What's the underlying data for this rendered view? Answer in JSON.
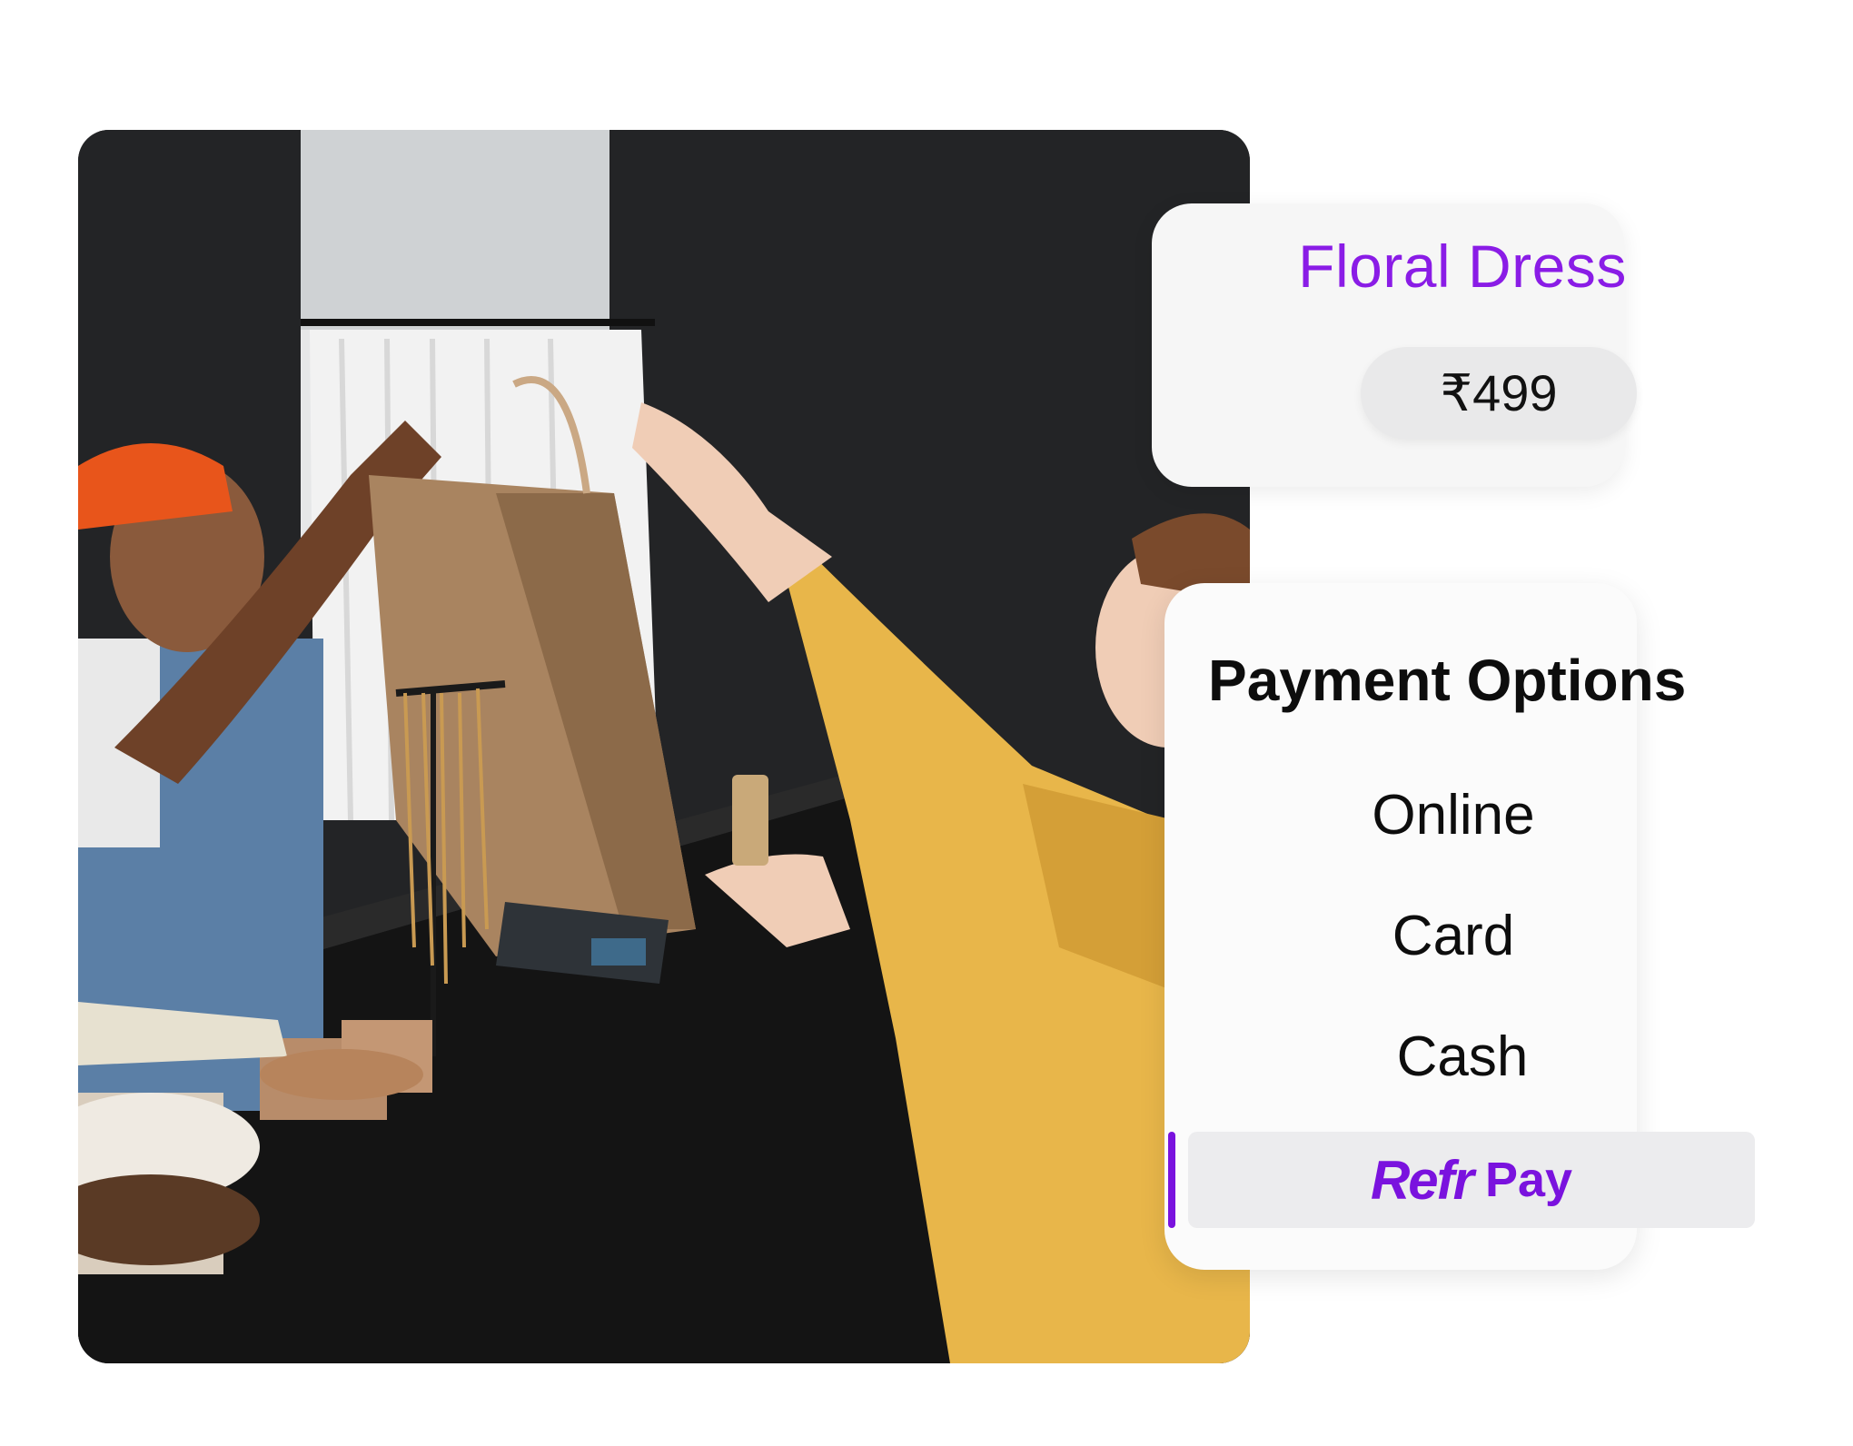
{
  "product": {
    "name": "Floral Dress",
    "price": "₹499"
  },
  "payment": {
    "title": "Payment Options",
    "options": [
      "Online",
      "Card",
      "Cash"
    ],
    "selected": {
      "brand": "Refr",
      "suffix": "Pay"
    }
  },
  "colors": {
    "accent": "#7a12de",
    "product_title": "#8a1ce6",
    "pill": "#e9e9ea",
    "card": "#f6f6f6"
  },
  "icons": {
    "photo": "checkout-shop-photo"
  }
}
